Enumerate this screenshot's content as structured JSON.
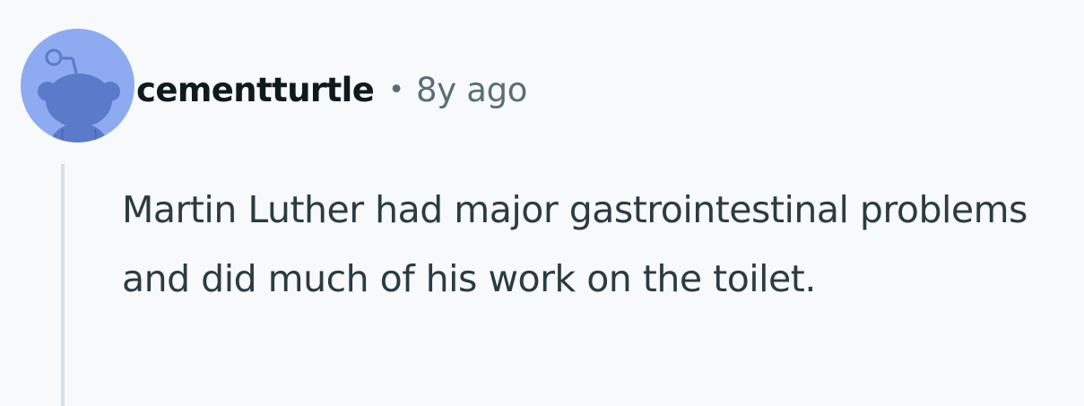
{
  "comment": {
    "avatar_icon": "reddit-snoo-avatar-icon",
    "username": "cementturtle",
    "separator": "•",
    "timestamp": "8y ago",
    "body": "Martin Luther had major gastrointestinal problems and did much of his work on the toilet."
  },
  "colors": {
    "background": "#f7f9fb",
    "avatar_background": "#8eabf2",
    "avatar_snoo": "#5b7ac9",
    "username": "#0f1a1c",
    "meta_text": "#576f76",
    "body_text": "#2a3c42",
    "thread_line": "#d6e0e6"
  }
}
